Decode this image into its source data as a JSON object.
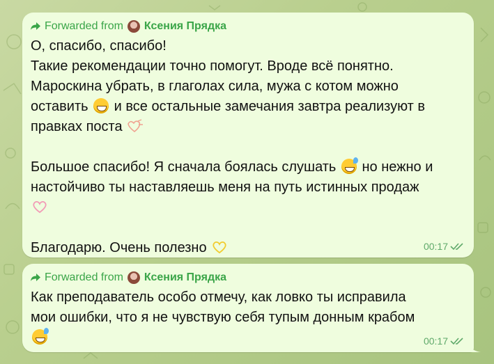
{
  "colors": {
    "bubble": "#effdde",
    "accent": "#3aa548",
    "time": "#5fa96a",
    "text": "#111111"
  },
  "messages": [
    {
      "forward_prefix": "Forwarded from",
      "forward_author": "Ксения Прядка",
      "lines": {
        "l1": "О, спасибо, спасибо!",
        "l2": "Такие рекомендации точно помогут. Вроде всё понятно.",
        "l3": "Мароскина убрать, в глаголах сила, мужа с котом можно",
        "l4a": "оставить ",
        "l4b": " и все остальные замечания завтра реализуют в",
        "l5": "правках поста ",
        "l6a": "Большое спасибо! Я сначала боялась слушать ",
        "l6b": " но нежно и",
        "l7": "настойчиво ты наставляешь меня на путь истинных продаж",
        "l8": "Благодарю. Очень полезно "
      },
      "emojis": [
        "grinning-face",
        "heart-doodle",
        "sweat-smile",
        "pink-heart-outline",
        "yellow-heart-outline"
      ],
      "time": "00:17",
      "status": "read-double-check"
    },
    {
      "forward_prefix": "Forwarded from",
      "forward_author": "Ксения Прядка",
      "lines": {
        "l1": "Как преподаватель особо отмечу, как ловко ты исправила",
        "l2": "мои ошибки, что я не чувствую себя тупым донным крабом"
      },
      "emojis": [
        "sweat-smile"
      ],
      "time": "00:17",
      "status": "read-double-check"
    }
  ]
}
